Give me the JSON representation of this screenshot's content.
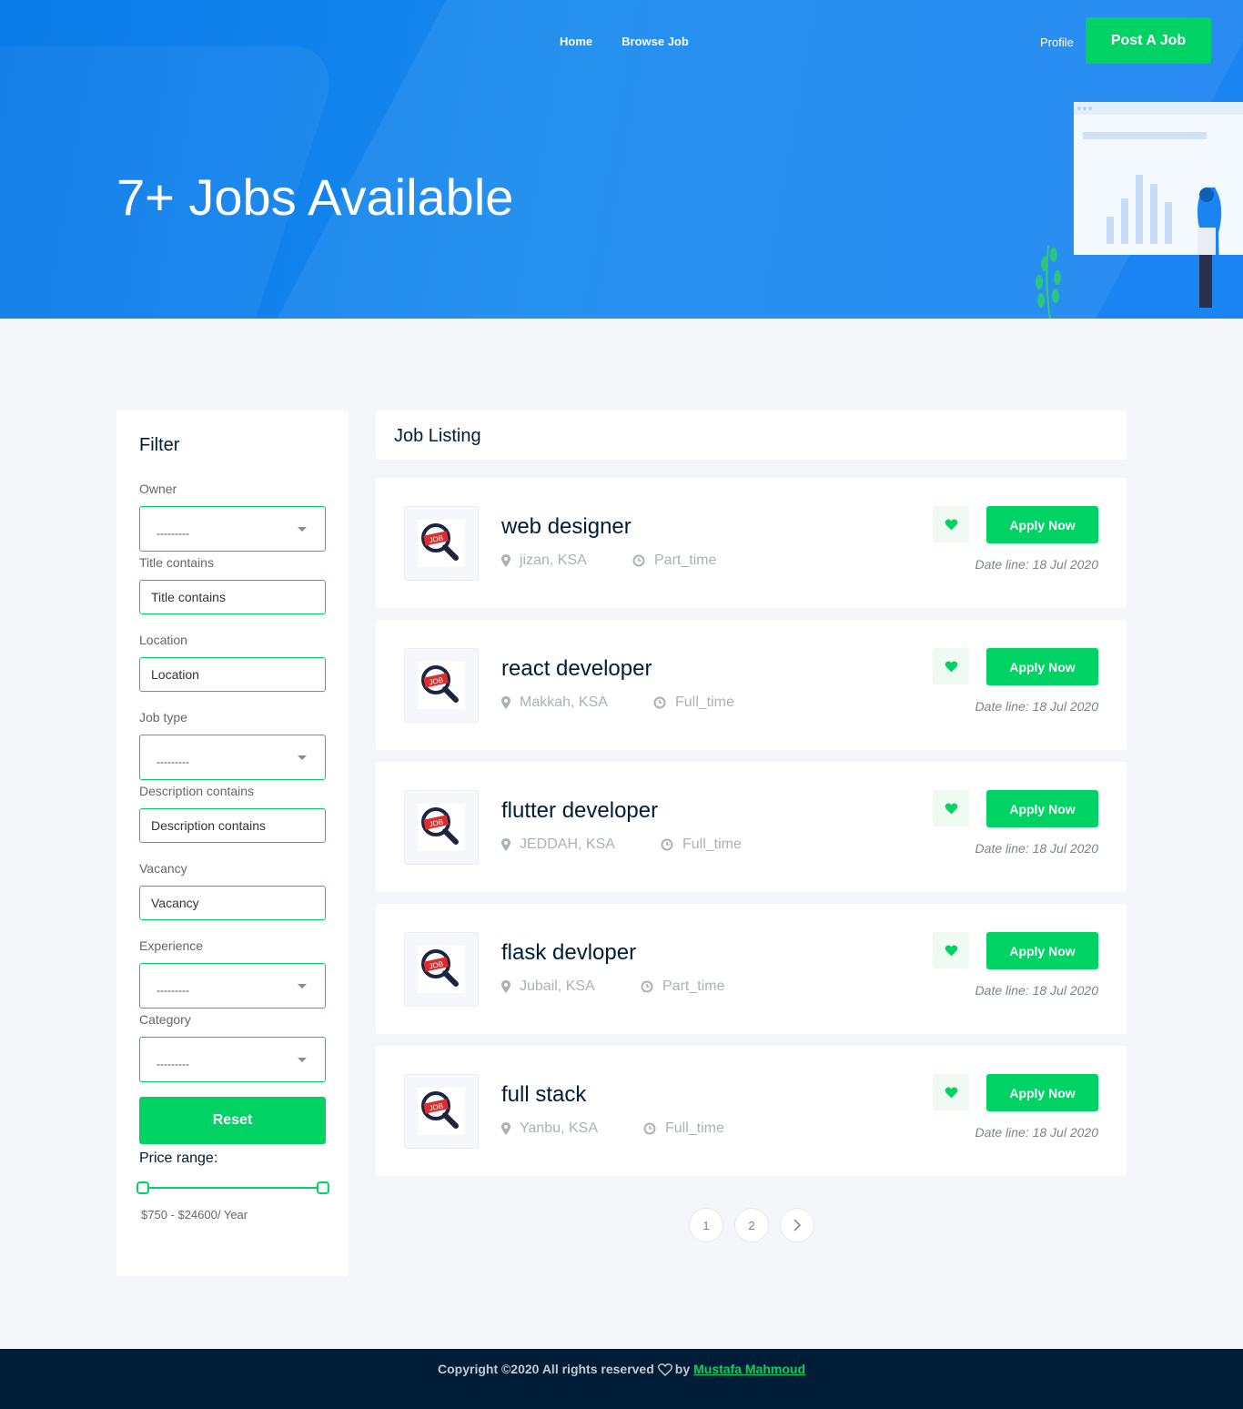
{
  "nav": {
    "home": "Home",
    "browse": "Browse Job",
    "profile": "Profile",
    "post_job": "Post A Job"
  },
  "hero": {
    "title": "7+ Jobs Available"
  },
  "filter": {
    "title": "Filter",
    "owner_label": "Owner",
    "owner_value": "---------",
    "title_label": "Title contains",
    "title_placeholder": "Title contains",
    "location_label": "Location",
    "location_placeholder": "Location",
    "jobtype_label": "Job type",
    "jobtype_value": "---------",
    "desc_label": "Description contains",
    "desc_placeholder": "Description contains",
    "vacancy_label": "Vacancy",
    "vacancy_placeholder": "Vacancy",
    "experience_label": "Experience",
    "experience_value": "---------",
    "category_label": "Category",
    "category_value": "---------",
    "reset": "Reset",
    "price_label": "Price range:",
    "price_value": "$750 - $24600/ Year"
  },
  "listing": {
    "header": "Job Listing",
    "jobs": [
      {
        "title": "web designer",
        "location": "jizan, KSA",
        "type": "Part_time",
        "apply": "Apply Now",
        "date_prefix": "Date line:",
        "date": "18 Jul 2020"
      },
      {
        "title": "react developer",
        "location": "Makkah, KSA",
        "type": "Full_time",
        "apply": "Apply Now",
        "date_prefix": "Date line:",
        "date": "18 Jul 2020"
      },
      {
        "title": "flutter developer",
        "location": "JEDDAH, KSA",
        "type": "Full_time",
        "apply": "Apply Now",
        "date_prefix": "Date line:",
        "date": "18 Jul 2020"
      },
      {
        "title": "flask devloper",
        "location": "Jubail, KSA",
        "type": "Part_time",
        "apply": "Apply Now",
        "date_prefix": "Date line:",
        "date": "18 Jul 2020"
      },
      {
        "title": "full stack",
        "location": "Yanbu, KSA",
        "type": "Full_time",
        "apply": "Apply Now",
        "date_prefix": "Date line:",
        "date": "18 Jul 2020"
      }
    ],
    "logo_text": "JOB"
  },
  "pagination": {
    "pages": [
      "1",
      "2"
    ],
    "next": "›"
  },
  "footer": {
    "text": "Copyright ©2020 All rights reserved",
    "by": "by",
    "author": "Mustafa Mahmoud"
  },
  "colors": {
    "accent": "#00d363",
    "hero": "#0a7ae8",
    "footer": "#001d38"
  }
}
